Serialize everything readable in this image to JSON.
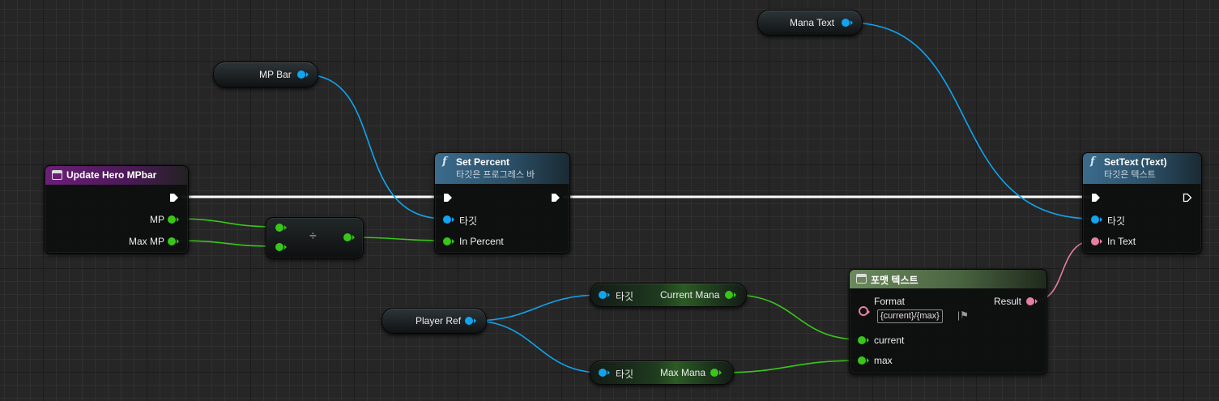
{
  "editor": {
    "colors": {
      "exec_wire": "#ffffff",
      "object_wire": "#10a5f0",
      "float_wire": "#38c718",
      "text_wire": "#e57fa3",
      "event_header": "#6c1f78",
      "function_header": "#3b6b8c",
      "format_header": "#6b8a5c"
    }
  },
  "nodes": {
    "event": {
      "title": "Update Hero MPbar",
      "pins": {
        "mp": "MP",
        "max_mp": "Max MP"
      }
    },
    "divide": {
      "symbol": "÷"
    },
    "mp_bar": {
      "label": "MP Bar"
    },
    "mana_text": {
      "label": "Mana Text"
    },
    "set_percent": {
      "icon": "f",
      "title": "Set Percent",
      "subtitle": "타깃은 프로그레스 바",
      "pins": {
        "target": "타깃",
        "in_percent": "In Percent"
      }
    },
    "set_text": {
      "icon": "f",
      "title": "SetText (Text)",
      "subtitle": "타깃은 텍스트",
      "pins": {
        "target": "타깃",
        "in_text": "In Text"
      }
    },
    "player_ref": {
      "label": "Player Ref"
    },
    "get_current_mana": {
      "target": "타깃",
      "label": "Current Mana"
    },
    "get_max_mana": {
      "target": "타깃",
      "label": "Max Mana"
    },
    "format_text": {
      "title": "포맷 텍스트",
      "format_label": "Format",
      "format_value": "{current}/{max}",
      "result": "Result",
      "pins": {
        "current": "current",
        "max": "max"
      }
    }
  }
}
